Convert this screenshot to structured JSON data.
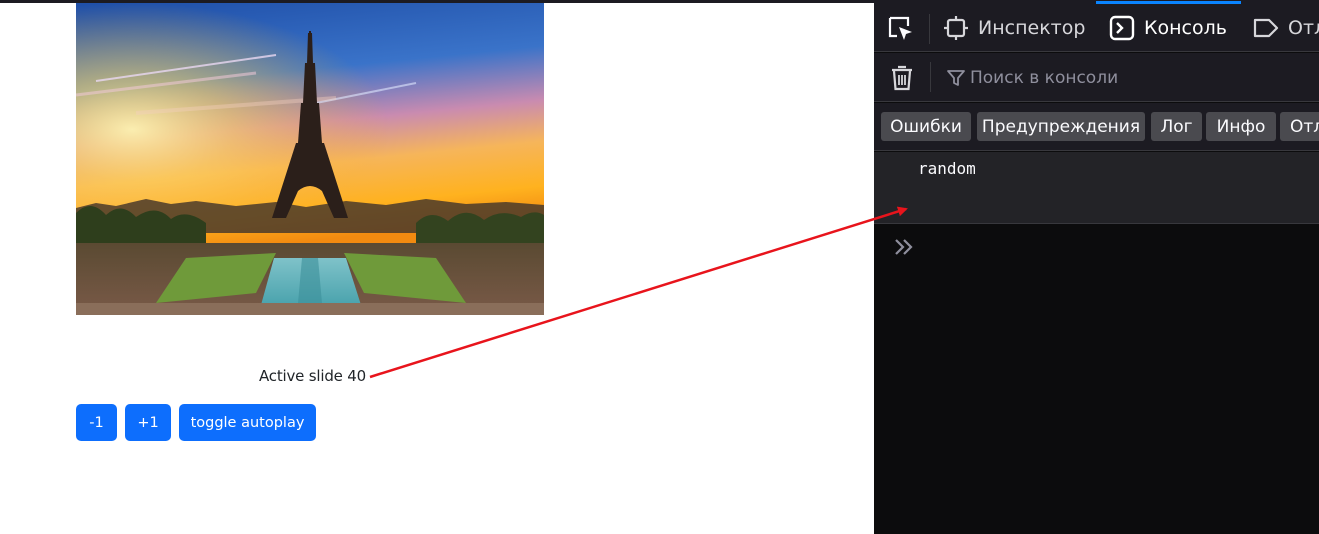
{
  "page": {
    "slide_image": "eiffel-tower-sunset-photo",
    "active_slide_label": "Active slide 40",
    "buttons": {
      "prev": "-1",
      "next": "+1",
      "toggle": "toggle autoplay"
    },
    "colors": {
      "button_bg": "#0d6efd",
      "annotation_arrow": "#e8141c"
    }
  },
  "devtools": {
    "tabs": [
      {
        "label": "Инспектор",
        "icon": "inspector-icon"
      },
      {
        "label": "Консоль",
        "icon": "console-icon"
      },
      {
        "label": "Отл",
        "icon": "debugger-icon"
      }
    ],
    "toolbar": {
      "trash_icon": "trash-icon",
      "filter_icon": "filter-icon",
      "search_placeholder": "Поиск в консоли"
    },
    "filters": [
      "Ошибки",
      "Предупреждения",
      "Лог",
      "Инфо",
      "Отл"
    ],
    "log_messages": [
      "random"
    ],
    "prompt_icon": "double-chevron-icon",
    "colors": {
      "bg": "#1c1b22",
      "panel": "#0c0c0d",
      "filter_btn": "#4a4a4f",
      "accent": "#0a84ff"
    }
  }
}
